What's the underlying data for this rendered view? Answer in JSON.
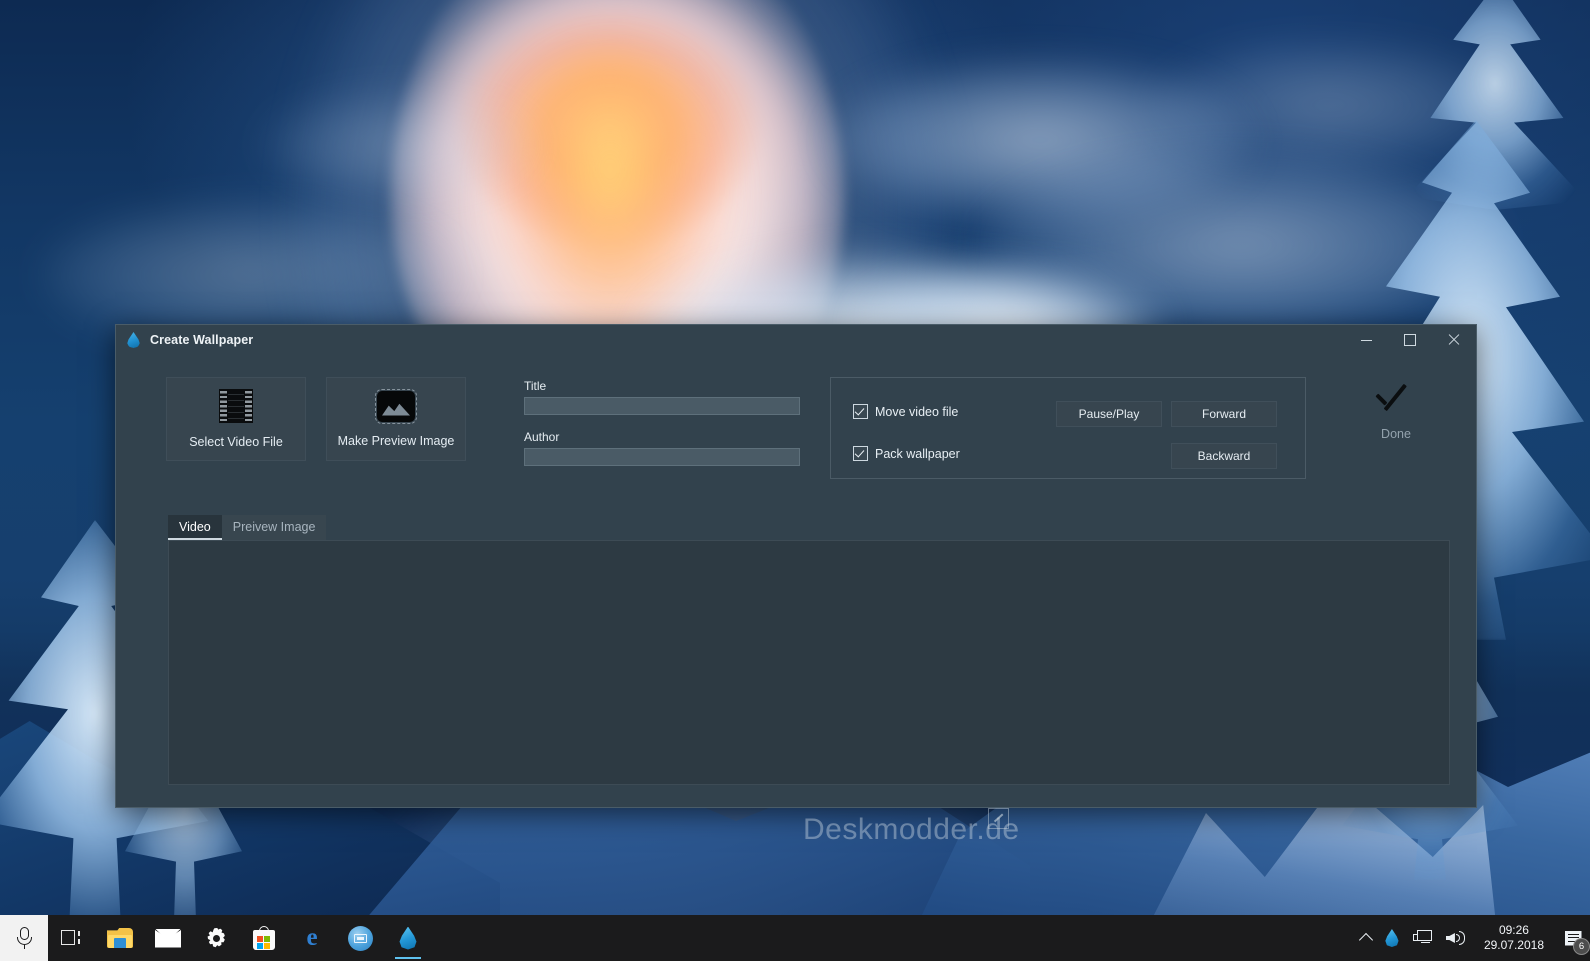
{
  "window": {
    "title": "Create Wallpaper",
    "icon": "water-drop-icon",
    "minimize_label": "Minimize",
    "maximize_label": "Maximize",
    "close_label": "Close"
  },
  "actions": {
    "select_video_label": "Select Video File",
    "make_preview_label": "Make Preview Image"
  },
  "fields": {
    "title_label": "Title",
    "title_value": "",
    "title_placeholder": "",
    "author_label": "Author",
    "author_value": "",
    "author_placeholder": ""
  },
  "options": {
    "move_video_label": "Move video file",
    "move_video_checked": true,
    "pack_wallpaper_label": "Pack wallpaper",
    "pack_wallpaper_checked": true,
    "pause_play_label": "Pause/Play",
    "forward_label": "Forward",
    "backward_label": "Backward"
  },
  "done": {
    "label": "Done",
    "icon": "checkmark-icon"
  },
  "tabs": [
    {
      "label": "Video",
      "active": true
    },
    {
      "label": "Preivew Image",
      "active": false
    }
  ],
  "watermark": {
    "text": "Deskmodder.de"
  },
  "taskbar": {
    "start_icon": "microphone-icon",
    "task_view_icon": "task-view-icon",
    "items": [
      {
        "name": "file-explorer",
        "icon": "folder-icon",
        "active": false
      },
      {
        "name": "mail",
        "icon": "envelope-icon",
        "active": false
      },
      {
        "name": "settings",
        "icon": "gear-icon",
        "active": false
      },
      {
        "name": "microsoft-store",
        "icon": "shopping-bag-icon",
        "active": false
      },
      {
        "name": "microsoft-edge",
        "icon": "edge-icon",
        "glyph": "e",
        "active": false
      },
      {
        "name": "media-app",
        "icon": "blue-circle-icon",
        "active": false
      },
      {
        "name": "create-wallpaper",
        "icon": "water-drop-icon",
        "active": true
      }
    ],
    "tray": {
      "show_hidden_icons": "chevron-up-icon",
      "app_icon": "water-drop-icon",
      "network_icon": "network-icon",
      "volume_icon": "speaker-icon",
      "time": "09:26",
      "date": "29.07.2018",
      "action_center_icon": "notifications-icon",
      "notification_count": "6"
    }
  },
  "colors": {
    "dialog_bg": "#32424d",
    "panel_bg": "#2d3a43",
    "button_bg": "#37454f",
    "input_bg": "#4a5b66",
    "text": "#e6edf2",
    "muted_text": "#93a2ad",
    "accent": "#2397d6",
    "taskbar_bg": "#1b1b1c"
  }
}
